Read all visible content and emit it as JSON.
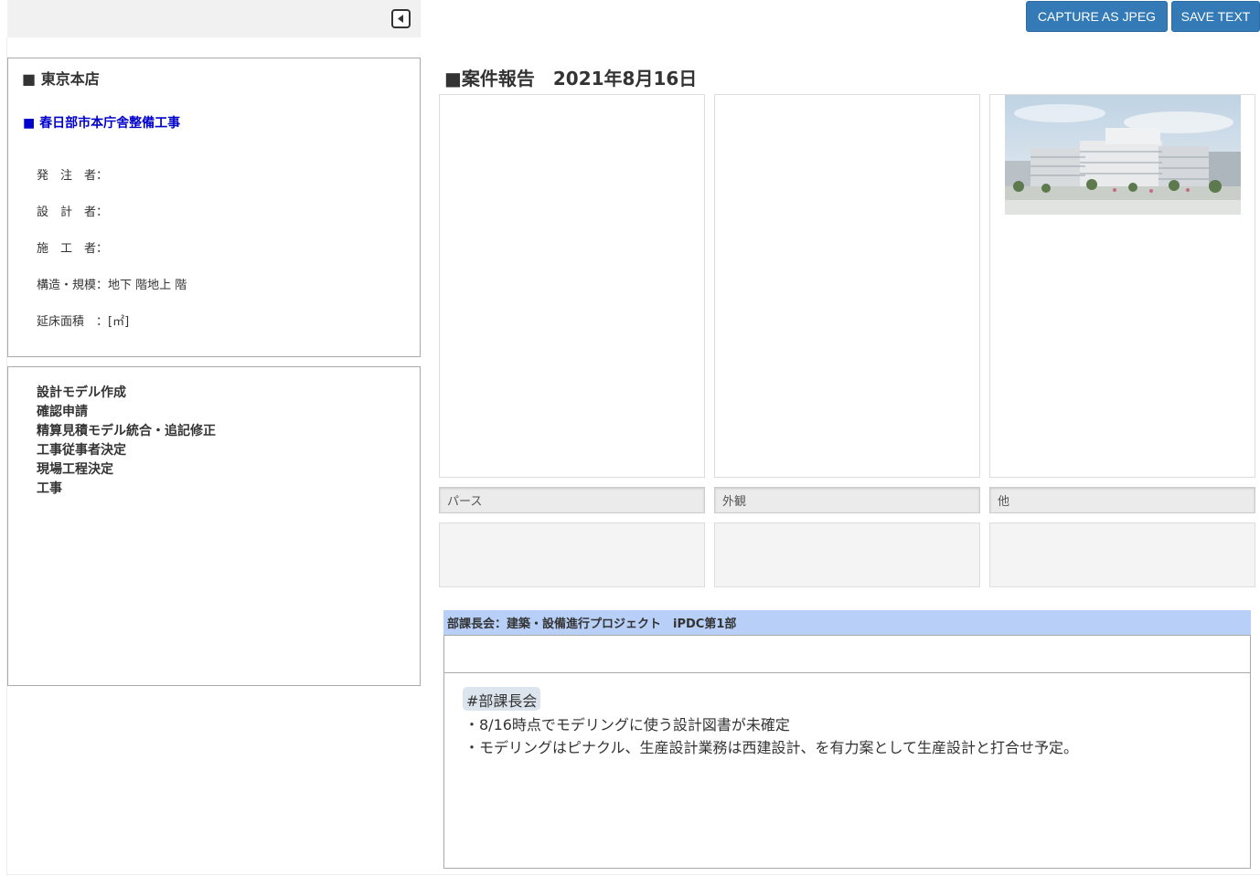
{
  "toolbar": {
    "capture_label": "CAPTURE AS JPEG",
    "save_label": "SAVE TEXT"
  },
  "info": {
    "branch": "■ 東京本店",
    "project": "■ 春日部市本庁舎整備工事",
    "rows": [
      "発　注　者：",
      "設　計　者：",
      "施　工　者：",
      "構造・規模：地下 階地上 階",
      "延床面積　：[㎡]"
    ]
  },
  "tasks": [
    "設計モデル作成",
    "確認申請",
    "精算見積モデル統合・追記修正",
    "工事従事者決定",
    "現場工程決定",
    "工事"
  ],
  "report": {
    "heading": "■案件報告　2021年8月16日",
    "captions": [
      "パース",
      "外観",
      "他"
    ]
  },
  "meeting": {
    "header": "部課長会：建築・設備進行プロジェクト　iPDC第1部",
    "tag": "#部課長会",
    "lines": [
      "・8/16時点でモデリングに使う設計図書が未確定",
      "・モデリングはピナクル、生産設計業務は西建設計、を有力案として生産設計と打合せ予定。"
    ]
  },
  "colors": {
    "button_blue": "#337ab7",
    "project_link": "#0000cc",
    "meeting_header_bg": "#b8d0f8"
  },
  "icons": {
    "collapse": "caret-left-square-icon",
    "photo": "building-photo"
  }
}
